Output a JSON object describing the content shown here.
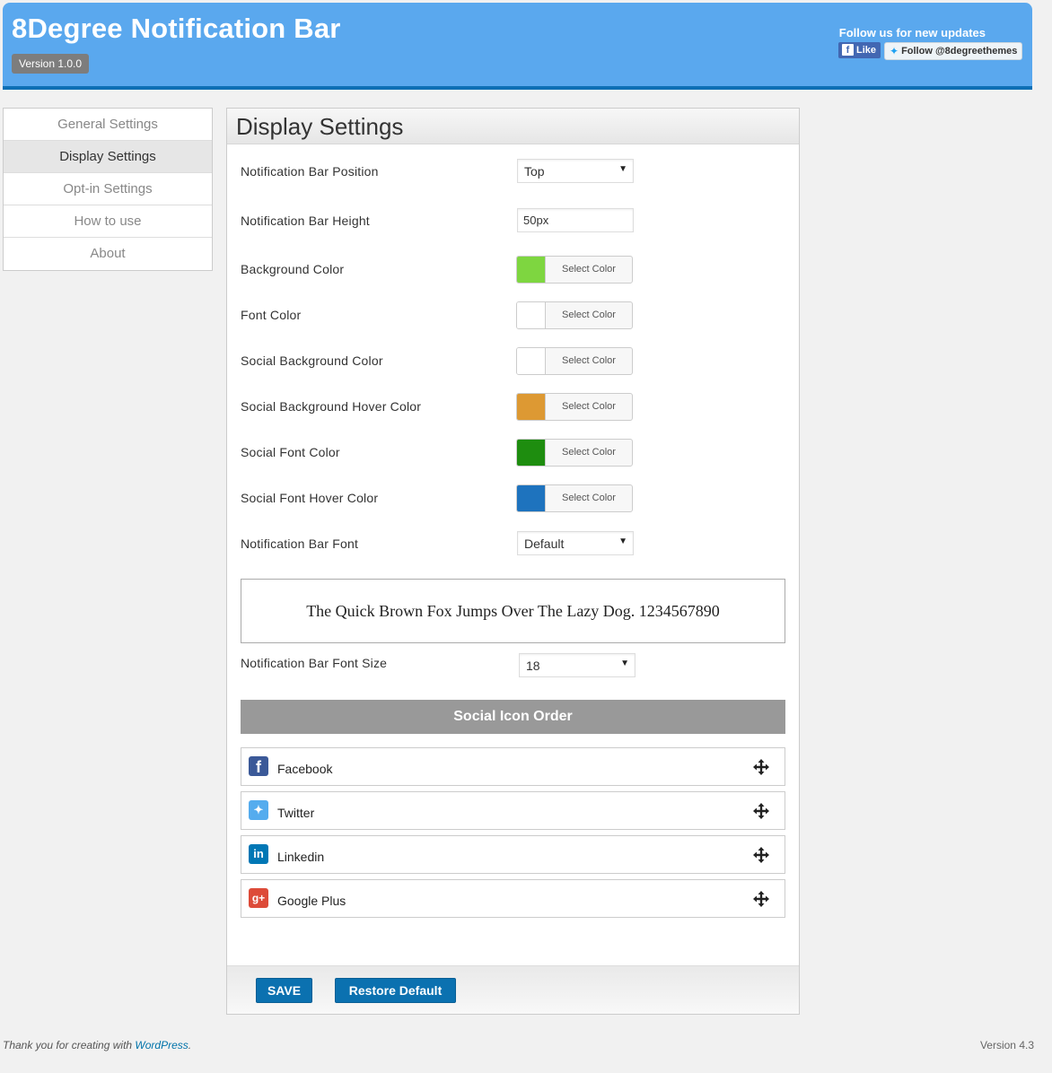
{
  "header": {
    "title": "8Degree Notification Bar",
    "version": "Version 1.0.0",
    "follow_text": "Follow us for new updates",
    "fb_like_label": "Like",
    "twitter_follow_label": "Follow @8degreethemes"
  },
  "sidebar": {
    "items": [
      {
        "label": "General Settings",
        "active": false
      },
      {
        "label": "Display Settings",
        "active": true
      },
      {
        "label": "Opt-in Settings",
        "active": false
      },
      {
        "label": "How to use",
        "active": false
      },
      {
        "label": "About",
        "active": false
      }
    ]
  },
  "panel": {
    "title": "Display Settings",
    "position": {
      "label": "Notification Bar Position",
      "value": "Top"
    },
    "height": {
      "label": "Notification Bar Height",
      "value": "50px"
    },
    "select_color_label": "Select Color",
    "colors": [
      {
        "label": "Background Color",
        "color": "#7ed640"
      },
      {
        "label": "Font Color",
        "color": "#ffffff"
      },
      {
        "label": "Social Background Color",
        "color": "#ffffff"
      },
      {
        "label": "Social Background Hover Color",
        "color": "#dd9933"
      },
      {
        "label": "Social Font Color",
        "color": "#1e8d0f"
      },
      {
        "label": "Social Font Hover Color",
        "color": "#1e73be"
      }
    ],
    "font": {
      "label": "Notification Bar Font",
      "value": "Default"
    },
    "preview_text": "The Quick Brown Fox Jumps Over The Lazy Dog. 1234567890",
    "font_size": {
      "label": "Notification Bar Font Size",
      "value": "18"
    },
    "social_order_title": "Social Icon Order",
    "social_items": [
      {
        "name": "Facebook",
        "icon": "facebook-icon",
        "color": "#3b5998"
      },
      {
        "name": "Twitter",
        "icon": "twitter-icon",
        "color": "#55acee"
      },
      {
        "name": "Linkedin",
        "icon": "linkedin-icon",
        "color": "#0077b5"
      },
      {
        "name": "Google Plus",
        "icon": "google-plus-icon",
        "color": "#dd4b39"
      }
    ],
    "save_label": "SAVE",
    "restore_label": "Restore Default"
  },
  "footer": {
    "thanks_prefix": "Thank you for creating with ",
    "wordpress_link": "WordPress",
    "thanks_suffix": ".",
    "version": "Version 4.3"
  }
}
